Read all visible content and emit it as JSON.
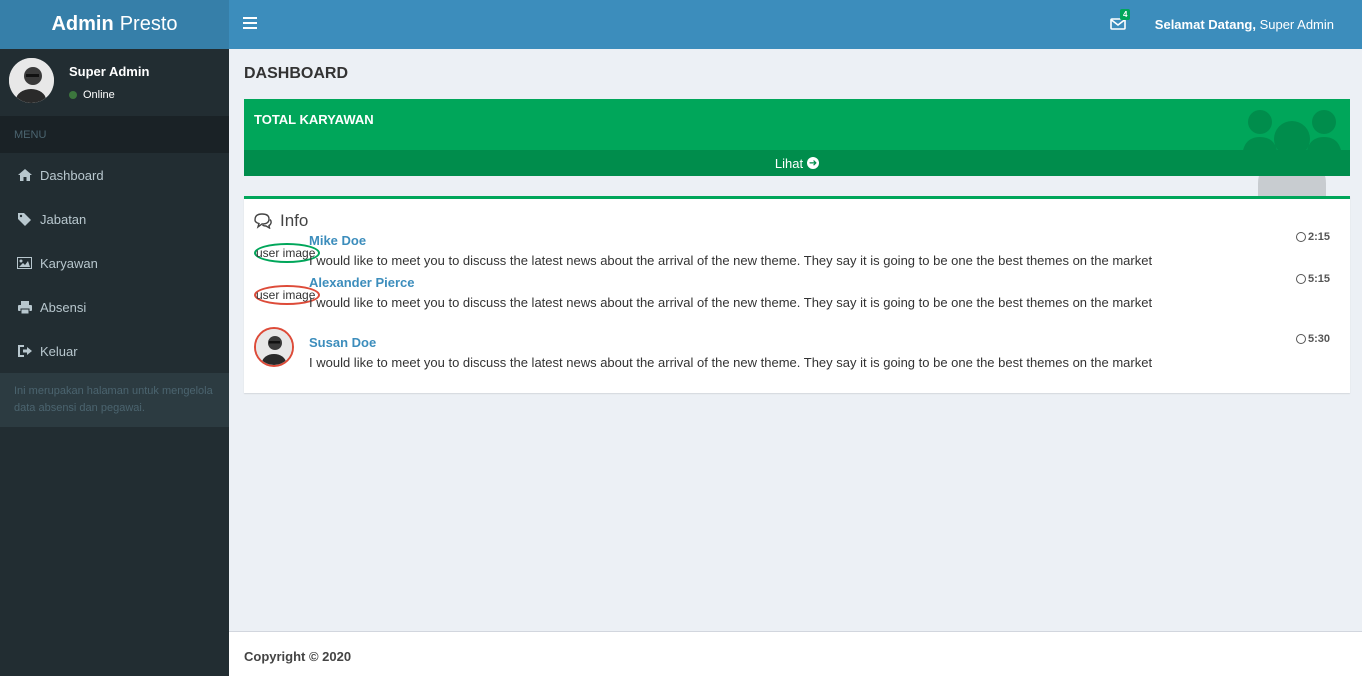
{
  "brand": {
    "bold": "Admin",
    "light": "Presto"
  },
  "header": {
    "mail_count": "4",
    "welcome_bold": "Selamat Datang,",
    "welcome_name": " Super Admin"
  },
  "sidebar": {
    "user_name": "Super Admin",
    "status": "Online",
    "menu_header": "MENU",
    "items": [
      {
        "label": "Dashboard",
        "icon": "home-icon"
      },
      {
        "label": "Jabatan",
        "icon": "tag-icon"
      },
      {
        "label": "Karyawan",
        "icon": "image-icon"
      },
      {
        "label": "Absensi",
        "icon": "print-icon"
      },
      {
        "label": "Keluar",
        "icon": "sign-out-icon"
      }
    ],
    "note": "Ini merupakan halaman untuk mengelola data absensi dan pegawai."
  },
  "main": {
    "title": "DASHBOARD",
    "total_box": {
      "title": "TOTAL KARYAWAN",
      "link": "Lihat"
    },
    "info": {
      "title": "Info",
      "messages": [
        {
          "name": "Mike Doe",
          "img_alt": "user image",
          "text": "I would like to meet you to discuss the latest news about the arrival of the new theme. They say it is going to be one the best themes on the market",
          "time": "2:15"
        },
        {
          "name": "Alexander Pierce",
          "img_alt": "user image",
          "text": "I would like to meet you to discuss the latest news about the arrival of the new theme. They say it is going to be one the best themes on the market",
          "time": "5:15"
        },
        {
          "name": "Susan Doe",
          "img_alt": "",
          "text": "I would like to meet you to discuss the latest news about the arrival of the new theme. They say it is going to be one the best themes on the market",
          "time": "5:30"
        }
      ]
    }
  },
  "footer": {
    "copyright": "Copyright © 2020"
  },
  "colors": {
    "header": "#3c8dbc",
    "logo": "#367fa9",
    "sidebar": "#222d32",
    "success": "#00a65a",
    "danger": "#dd4b39"
  }
}
